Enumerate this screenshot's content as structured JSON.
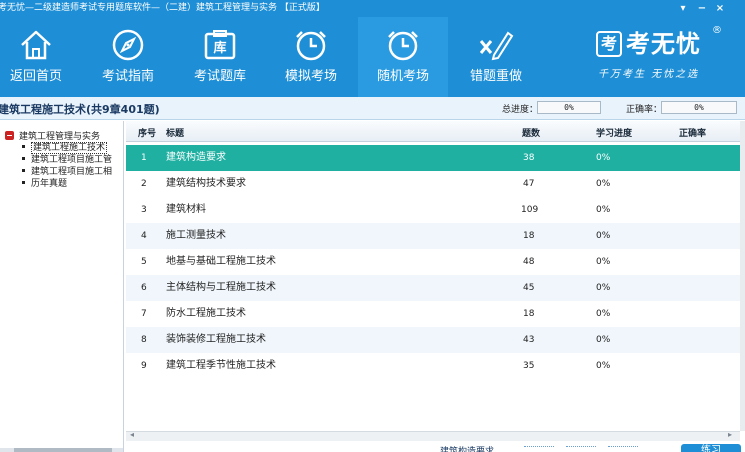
{
  "window": {
    "title": "考无忧—二级建造师考试专用题库软件—（二建）建筑工程管理与实务 【正式版】",
    "controls": [
      "▾",
      "−",
      "×"
    ]
  },
  "toolbar": {
    "items": [
      {
        "label": "返回首页",
        "icon": "home-icon"
      },
      {
        "label": "考试指南",
        "icon": "compass-icon"
      },
      {
        "label": "考试题库",
        "icon": "library-icon",
        "icon_text": "库"
      },
      {
        "label": "模拟考场",
        "icon": "clock-icon"
      },
      {
        "label": "随机考场",
        "icon": "clock-icon"
      },
      {
        "label": "错题重做",
        "icon": "redo-icon"
      }
    ],
    "active_index": 4
  },
  "logo": {
    "mark": "考",
    "brand": "考无忧",
    "reg": "®",
    "slogan": "千万考生  无忧之选"
  },
  "header": {
    "chapter_title": "建筑工程施工技术(共9章401题)",
    "progress_label": "总进度：",
    "progress_value": "0%",
    "accuracy_label": "正确率：",
    "accuracy_value": "0%"
  },
  "tree": {
    "root": "建筑工程管理与实务",
    "children": [
      "建筑工程施工技术",
      "建筑工程项目施工管",
      "建筑工程项目施工相",
      "历年真题"
    ],
    "selected_index": 0
  },
  "table": {
    "columns": [
      "序号",
      "标题",
      "题数",
      "学习进度",
      "正确率"
    ],
    "rows": [
      {
        "num": "1",
        "title": "建筑构造要求",
        "count": "38",
        "progress": "0%",
        "accuracy": ""
      },
      {
        "num": "2",
        "title": "建筑结构技术要求",
        "count": "47",
        "progress": "0%",
        "accuracy": ""
      },
      {
        "num": "3",
        "title": "建筑材料",
        "count": "109",
        "progress": "0%",
        "accuracy": ""
      },
      {
        "num": "4",
        "title": "施工测量技术",
        "count": "18",
        "progress": "0%",
        "accuracy": ""
      },
      {
        "num": "5",
        "title": "地基与基础工程施工技术",
        "count": "48",
        "progress": "0%",
        "accuracy": ""
      },
      {
        "num": "6",
        "title": "主体结构与工程施工技术",
        "count": "45",
        "progress": "0%",
        "accuracy": ""
      },
      {
        "num": "7",
        "title": "防水工程施工技术",
        "count": "18",
        "progress": "0%",
        "accuracy": ""
      },
      {
        "num": "8",
        "title": "装饰装修工程施工技术",
        "count": "43",
        "progress": "0%",
        "accuracy": ""
      },
      {
        "num": "9",
        "title": "建筑工程季节性施工技术",
        "count": "35",
        "progress": "0%",
        "accuracy": ""
      }
    ],
    "selected_index": 0
  },
  "footer": {
    "hint": "建筑构造要求",
    "practice_button": "练习"
  },
  "colors": {
    "brand_blue": "#1e8fd6",
    "selected_row": "#20b0a2",
    "alt_row": "#f0f6fb"
  }
}
